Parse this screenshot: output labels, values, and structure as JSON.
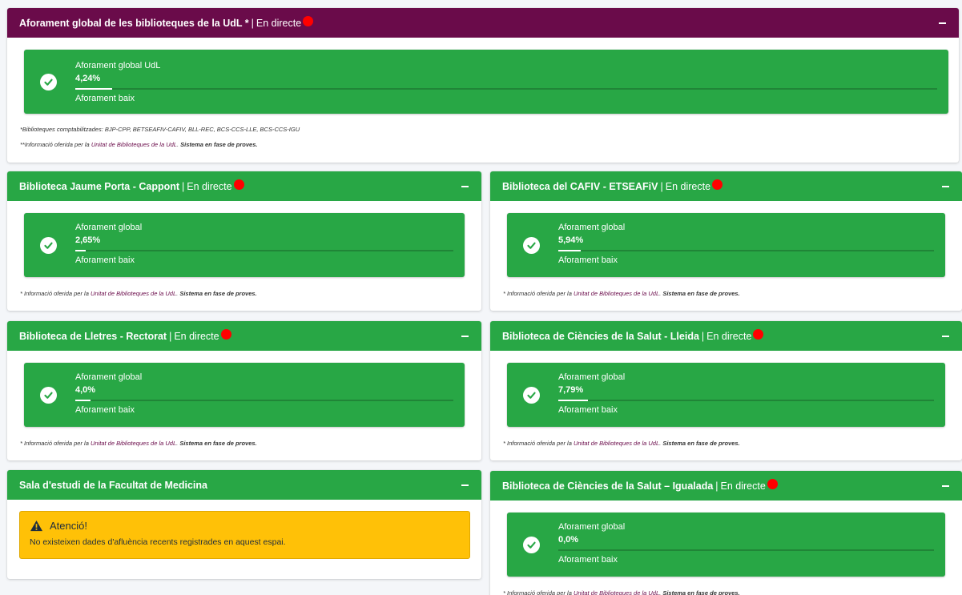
{
  "live_label": "En directe",
  "separator": "|",
  "note_prefix": "* Informació oferida per la",
  "note_link": "Unitat de Biblioteques de la UdL",
  "note_period": ".",
  "note_bold": "Sistema en fase de proves.",
  "colors": {
    "green": "#28a745",
    "purple": "#6a0b4a",
    "live_dot": "#ff0000",
    "alert": "#ffc107"
  },
  "global": {
    "title": "Aforament global de les biblioteques de la UdL *",
    "label": "Aforament global UdL",
    "value": "4,24%",
    "fill": 0.0424,
    "desc": "Aforament baix",
    "icon": "check-circle-icon",
    "note1": "*Biblioteques comptabilitzades: BJP-CPP, BETSEAFIV-CAFIV, BLL-REC, BCS-CCS-LLE, BCS-CCS-IGU",
    "note2_prefix": "**Informació oferida per la",
    "note2_link": "Unitat de Biblioteques de la UdL",
    "note2_period": ".",
    "note2_bold": "Sistema en fase de proves."
  },
  "libraries": [
    {
      "title": "Biblioteca Jaume Porta - Cappont",
      "label": "Aforament global",
      "value": "2,65%",
      "fill": 0.0265,
      "desc": "Aforament baix"
    },
    {
      "title": "Biblioteca del CAFIV - ETSEAFiV",
      "label": "Aforament global",
      "value": "5,94%",
      "fill": 0.0594,
      "desc": "Aforament baix"
    },
    {
      "title": "Biblioteca de Lletres - Rectorat",
      "label": "Aforament global",
      "value": "4,0%",
      "fill": 0.04,
      "desc": "Aforament baix"
    },
    {
      "title": "Biblioteca de Ciències de la Salut - Lleida",
      "label": "Aforament global",
      "value": "7,79%",
      "fill": 0.0779,
      "desc": "Aforament baix"
    },
    {
      "title": "Biblioteca de Ciències de la Salut – Igualada",
      "label": "Aforament global",
      "value": "0,0%",
      "fill": 0.0,
      "desc": "Aforament baix"
    }
  ],
  "medicina": {
    "title": "Sala d'estudi de la Facultat de Medicina",
    "alert_title": "Atenció!",
    "alert_text": "No existeixen dades d'afluència recents registrades en aquest espai.",
    "icon": "warning-triangle-icon"
  }
}
